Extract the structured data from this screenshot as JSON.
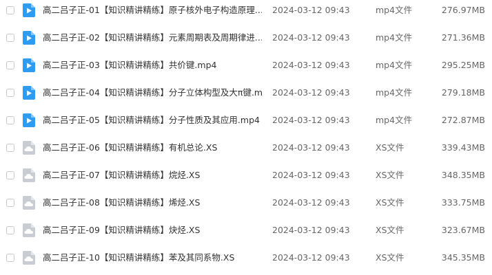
{
  "colors": {
    "video_icon": "#2f9bf1",
    "doc_icon": "#c9cdd3",
    "text_primary": "#333333",
    "text_secondary": "#666666"
  },
  "files": [
    {
      "name": "高二吕子正-01【知识精讲精练】原子核外电子构造原理....",
      "date": "2024-03-12 09:43",
      "type": "mp4文件",
      "size": "276.97MB",
      "icon": "video-file-icon"
    },
    {
      "name": "高二吕子正-02【知识精讲精练】元素周期表及周期律进...",
      "date": "2024-03-12 09:43",
      "type": "mp4文件",
      "size": "271.36MB",
      "icon": "video-file-icon"
    },
    {
      "name": "高二吕子正-03【知识精讲精练】共价键.mp4",
      "date": "2024-03-12 09:43",
      "type": "mp4文件",
      "size": "295.25MB",
      "icon": "video-file-icon"
    },
    {
      "name": "高二吕子正-04【知识精讲精练】分子立体构型及大π键.m...",
      "date": "2024-03-12 09:43",
      "type": "mp4文件",
      "size": "279.18MB",
      "icon": "video-file-icon"
    },
    {
      "name": "高二吕子正-05【知识精讲精练】分子性质及其应用.mp4",
      "date": "2024-03-12 09:43",
      "type": "mp4文件",
      "size": "272.87MB",
      "icon": "video-file-icon"
    },
    {
      "name": "高二吕子正-06【知识精讲精练】有机总论.XS",
      "date": "2024-03-12 09:43",
      "type": "XS文件",
      "size": "339.43MB",
      "icon": "cloud-file-icon"
    },
    {
      "name": "高二吕子正-07【知识精讲精练】烷烃.XS",
      "date": "2024-03-12 09:43",
      "type": "XS文件",
      "size": "348.35MB",
      "icon": "cloud-file-icon"
    },
    {
      "name": "高二吕子正-08【知识精讲精练】烯烃.XS",
      "date": "2024-03-12 09:43",
      "type": "XS文件",
      "size": "333.75MB",
      "icon": "cloud-file-icon"
    },
    {
      "name": "高二吕子正-09【知识精讲精练】炔烃.XS",
      "date": "2024-03-12 09:43",
      "type": "XS文件",
      "size": "323.67MB",
      "icon": "cloud-file-icon"
    },
    {
      "name": "高二吕子正-10【知识精讲精练】苯及其同系物.XS",
      "date": "2024-03-12 09:43",
      "type": "XS文件",
      "size": "345.35MB",
      "icon": "cloud-file-icon"
    }
  ]
}
